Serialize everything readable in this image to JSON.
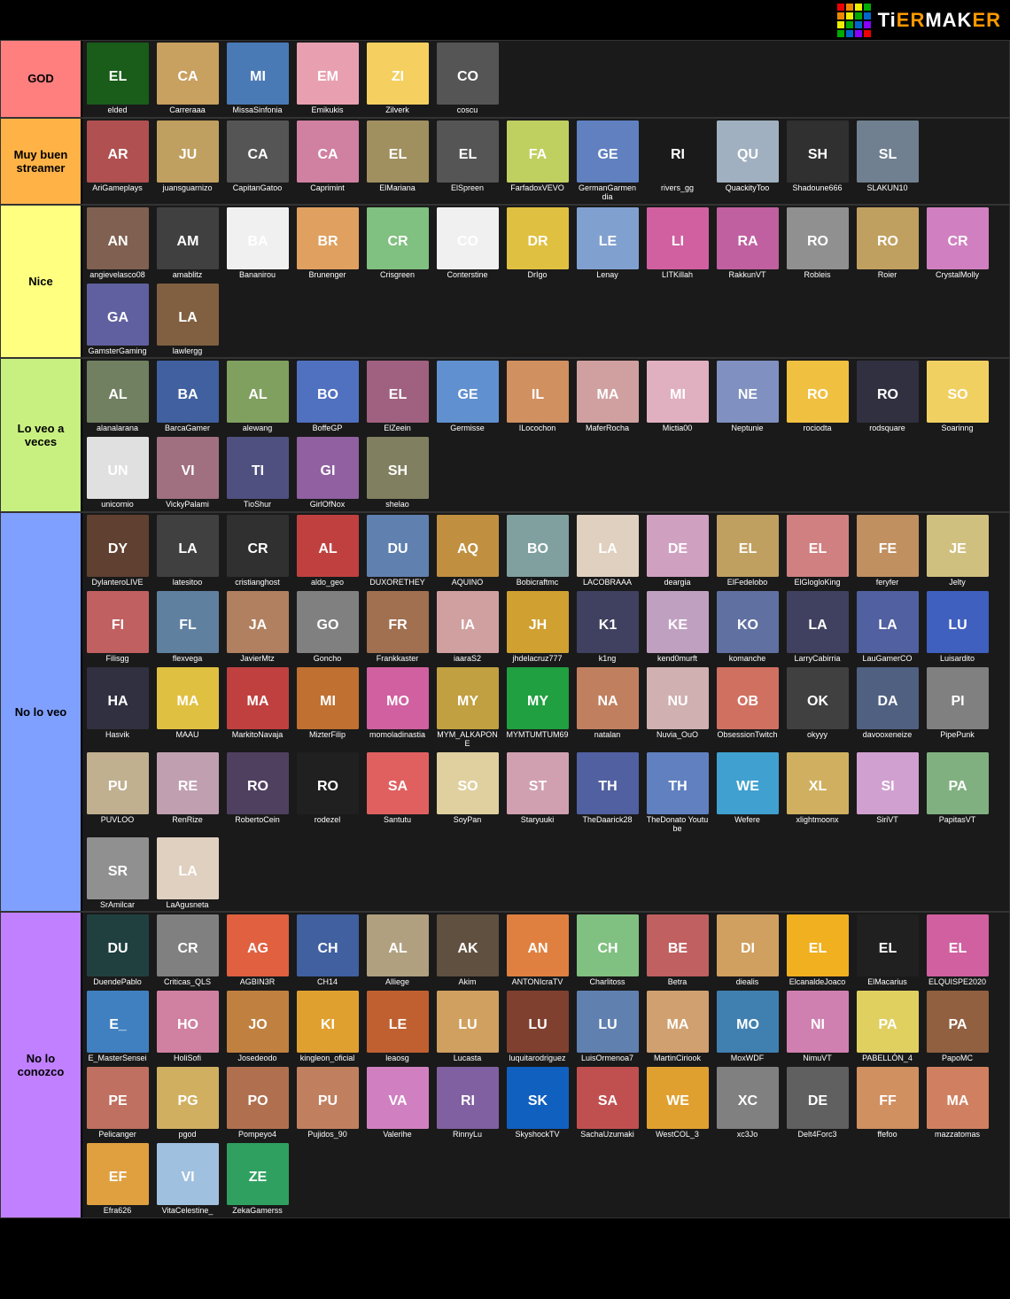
{
  "header": {
    "logo_text": "TiERMAKER"
  },
  "tiers": [
    {
      "id": "god",
      "label": "GOD",
      "color": "#ff7f7f",
      "streamers": [
        {
          "name": "elded",
          "color": "#1a5c1a"
        },
        {
          "name": "Carreraaa",
          "color": "#c8a060"
        },
        {
          "name": "MissaSinfonia",
          "color": "#4a7ab5"
        },
        {
          "name": "Emikukis",
          "color": "#e8a0b0"
        },
        {
          "name": "Zilverk",
          "color": "#f5d060"
        },
        {
          "name": "coscu",
          "color": "#555"
        }
      ]
    },
    {
      "id": "muy-buen-streamer",
      "label": "Muy buen streamer",
      "color": "#ffb347",
      "streamers": [
        {
          "name": "AriGameplays",
          "color": "#b05050"
        },
        {
          "name": "juansguarnizo",
          "color": "#c0a060"
        },
        {
          "name": "CapitanGatoo",
          "color": "#555"
        },
        {
          "name": "Caprimint",
          "color": "#d080a0"
        },
        {
          "name": "ElMariana",
          "color": "#a09060"
        },
        {
          "name": "ElSpreen",
          "color": "#555"
        },
        {
          "name": "FarfadoxVEVO",
          "color": "#c0d060"
        },
        {
          "name": "GermanGarmendia",
          "color": "#6080c0"
        },
        {
          "name": "rivers_gg",
          "color": "#1a1a1a"
        },
        {
          "name": "QuackityToo",
          "color": "#a0b0c0"
        },
        {
          "name": "Shadoune666",
          "color": "#303030"
        },
        {
          "name": "SLAKUN10",
          "color": "#708090"
        }
      ]
    },
    {
      "id": "nice",
      "label": "Nice",
      "color": "#ffff80",
      "streamers": [
        {
          "name": "angievelasco08",
          "color": "#806050"
        },
        {
          "name": "amablitz",
          "color": "#404040"
        },
        {
          "name": "Bananirou",
          "color": "#f0f0f0"
        },
        {
          "name": "Brunenger",
          "color": "#e0a060"
        },
        {
          "name": "Crisgreen",
          "color": "#80c080"
        },
        {
          "name": "Conterstine",
          "color": "#f0f0f0"
        },
        {
          "name": "DrIgo",
          "color": "#e0c040"
        },
        {
          "name": "Lenay",
          "color": "#80a0d0"
        },
        {
          "name": "LITKillah",
          "color": "#d060a0"
        },
        {
          "name": "RakkunVT",
          "color": "#c060a0"
        },
        {
          "name": "Robleis",
          "color": "#909090"
        },
        {
          "name": "Roier",
          "color": "#c0a060"
        },
        {
          "name": "CrystalMolly",
          "color": "#d080c0"
        },
        {
          "name": "GamsterGaming",
          "color": "#6060a0"
        },
        {
          "name": "lawlergg",
          "color": "#806040"
        }
      ]
    },
    {
      "id": "lo-veo-a-veces",
      "label": "Lo veo a veces",
      "color": "#c8f080",
      "streamers": [
        {
          "name": "alanalarana",
          "color": "#708060"
        },
        {
          "name": "BarcaGamer",
          "color": "#4060a0"
        },
        {
          "name": "alewang",
          "color": "#80a060"
        },
        {
          "name": "BoffeGP",
          "color": "#5070c0"
        },
        {
          "name": "ElZeein",
          "color": "#a06080"
        },
        {
          "name": "Germisse",
          "color": "#6090d0"
        },
        {
          "name": "ILocochon",
          "color": "#d09060"
        },
        {
          "name": "MaferRocha",
          "color": "#d0a0a0"
        },
        {
          "name": "Mictia00",
          "color": "#e0b0c0"
        },
        {
          "name": "Neptunie",
          "color": "#8090c0"
        },
        {
          "name": "rociodta",
          "color": "#f0c040"
        },
        {
          "name": "rodsquare",
          "color": "#303040"
        },
        {
          "name": "Soarinng",
          "color": "#f0d060"
        },
        {
          "name": "unicornio",
          "color": "#e0e0e0"
        },
        {
          "name": "VickyPalami",
          "color": "#a07080"
        },
        {
          "name": "TioShur",
          "color": "#505080"
        },
        {
          "name": "GirlOfNox",
          "color": "#9060a0"
        },
        {
          "name": "shelao",
          "color": "#808060"
        }
      ]
    },
    {
      "id": "no-lo-veo",
      "label": "No lo veo",
      "color": "#80a0ff",
      "streamers": [
        {
          "name": "DylanteroLIVE",
          "color": "#604030"
        },
        {
          "name": "latesitoo",
          "color": "#404040"
        },
        {
          "name": "cristianghost",
          "color": "#303030"
        },
        {
          "name": "aldo_geo",
          "color": "#c04040"
        },
        {
          "name": "DUXORETHEY",
          "color": "#6080b0"
        },
        {
          "name": "AQUINO",
          "color": "#c09040"
        },
        {
          "name": "Bobicraftmc",
          "color": "#80a0a0"
        },
        {
          "name": "LACOBRAAA",
          "color": "#e0d0c0"
        },
        {
          "name": "deargia",
          "color": "#d0a0c0"
        },
        {
          "name": "ElFedelobo",
          "color": "#c0a060"
        },
        {
          "name": "ElGlogloKing",
          "color": "#d08080"
        },
        {
          "name": "feryfer",
          "color": "#c09060"
        },
        {
          "name": "Jelty",
          "color": "#d0c080"
        },
        {
          "name": "Filisgg",
          "color": "#c06060"
        },
        {
          "name": "flexvega",
          "color": "#6080a0"
        },
        {
          "name": "JavierMtz",
          "color": "#b08060"
        },
        {
          "name": "Goncho",
          "color": "#808080"
        },
        {
          "name": "Frankkaster",
          "color": "#a07050"
        },
        {
          "name": "iaaraS2",
          "color": "#d0a0a0"
        },
        {
          "name": "jhdelacruz777",
          "color": "#d0a030"
        },
        {
          "name": "k1ng",
          "color": "#404060"
        },
        {
          "name": "kend0murft",
          "color": "#c0a0c0"
        },
        {
          "name": "komanche",
          "color": "#6070a0"
        },
        {
          "name": "LarryCabirria",
          "color": "#404060"
        },
        {
          "name": "LauGamerCO",
          "color": "#5060a0"
        },
        {
          "name": "Luisardito",
          "color": "#4060c0"
        },
        {
          "name": "Hasvik",
          "color": "#303040"
        },
        {
          "name": "MAAU",
          "color": "#e0c040"
        },
        {
          "name": "MarkitoNavaja",
          "color": "#c04040"
        },
        {
          "name": "MizterFilip",
          "color": "#c07030"
        },
        {
          "name": "momoladinastia",
          "color": "#d060a0"
        },
        {
          "name": "MYM_ALKAPONE",
          "color": "#c0a040"
        },
        {
          "name": "MYMTUMTUM69",
          "color": "#20a040"
        },
        {
          "name": "natalan",
          "color": "#c08060"
        },
        {
          "name": "Nuvia_OuO",
          "color": "#d0b0b0"
        },
        {
          "name": "ObsessionTwitch",
          "color": "#d07060"
        },
        {
          "name": "okyyy",
          "color": "#404040"
        },
        {
          "name": "davooxeneize",
          "color": "#506080"
        },
        {
          "name": "PipePunk",
          "color": "#808080"
        },
        {
          "name": "PUVLOO",
          "color": "#c0b090"
        },
        {
          "name": "RenRize",
          "color": "#c0a0b0"
        },
        {
          "name": "RobertoCein",
          "color": "#504060"
        },
        {
          "name": "rodezel",
          "color": "#202020"
        },
        {
          "name": "Santutu",
          "color": "#e06060"
        },
        {
          "name": "SoyPan",
          "color": "#e0d0a0"
        },
        {
          "name": "Staryuuki",
          "color": "#d0a0b0"
        },
        {
          "name": "TheDaarick28",
          "color": "#5060a0"
        },
        {
          "name": "TheDonato Youtube",
          "color": "#6080c0"
        },
        {
          "name": "Wefere",
          "color": "#40a0d0"
        },
        {
          "name": "xlightmoonx",
          "color": "#d0b060"
        },
        {
          "name": "SiriVT",
          "color": "#d0a0d0"
        },
        {
          "name": "PapitasVT",
          "color": "#80b080"
        },
        {
          "name": "SrAmilcar",
          "color": "#909090"
        },
        {
          "name": "LaAgusneta",
          "color": "#e0d0c0"
        }
      ]
    },
    {
      "id": "no-lo-conozco",
      "label": "No lo conozco",
      "color": "#c080ff",
      "streamers": [
        {
          "name": "DuendePablo",
          "color": "#204040"
        },
        {
          "name": "Criticas_QLS",
          "color": "#808080"
        },
        {
          "name": "AGBIN3R",
          "color": "#e06040"
        },
        {
          "name": "CH14",
          "color": "#4060a0"
        },
        {
          "name": "Alliege",
          "color": "#b0a080"
        },
        {
          "name": "Akim",
          "color": "#605040"
        },
        {
          "name": "ANTONIcraTV",
          "color": "#e08040"
        },
        {
          "name": "Charlitoss",
          "color": "#80c080"
        },
        {
          "name": "Betra",
          "color": "#c06060"
        },
        {
          "name": "diealis",
          "color": "#d0a060"
        },
        {
          "name": "ElcanaldeJoaco",
          "color": "#f0b020"
        },
        {
          "name": "ElMacarius",
          "color": "#202020"
        },
        {
          "name": "ELQUISPE2020",
          "color": "#d060a0"
        },
        {
          "name": "E_MasterSensei",
          "color": "#4080c0"
        },
        {
          "name": "HoliSofi",
          "color": "#d080a0"
        },
        {
          "name": "Josedeodo",
          "color": "#c08040"
        },
        {
          "name": "kingleon_oficial",
          "color": "#e0a030"
        },
        {
          "name": "leaosg",
          "color": "#c06030"
        },
        {
          "name": "Lucasta",
          "color": "#d0a060"
        },
        {
          "name": "luquitarodriguez",
          "color": "#804030"
        },
        {
          "name": "LuisOrmenoa7",
          "color": "#6080b0"
        },
        {
          "name": "MartinCiriook",
          "color": "#d0a070"
        },
        {
          "name": "MoxWDF",
          "color": "#4080b0"
        },
        {
          "name": "NimuVT",
          "color": "#d080b0"
        },
        {
          "name": "PABELLÓN_4",
          "color": "#e0d060"
        },
        {
          "name": "PapoMC",
          "color": "#906040"
        },
        {
          "name": "Pelicanger",
          "color": "#c07060"
        },
        {
          "name": "pgod",
          "color": "#d0b060"
        },
        {
          "name": "Pompeyo4",
          "color": "#b07050"
        },
        {
          "name": "Pujidos_90",
          "color": "#c08060"
        },
        {
          "name": "Valerihe",
          "color": "#d080c0"
        },
        {
          "name": "RinnyLu",
          "color": "#8060a0"
        },
        {
          "name": "SkyshockTV",
          "color": "#1060c0"
        },
        {
          "name": "SachaUzumaki",
          "color": "#c05050"
        },
        {
          "name": "WestCOL_3",
          "color": "#e0a030"
        },
        {
          "name": "xc3Jo",
          "color": "#808080"
        },
        {
          "name": "Delt4Forc3",
          "color": "#606060"
        },
        {
          "name": "ffefoo",
          "color": "#d09060"
        },
        {
          "name": "mazzatomas",
          "color": "#d08060"
        },
        {
          "name": "Efra626",
          "color": "#e0a040"
        },
        {
          "name": "VitaCelestine_",
          "color": "#a0c0e0"
        },
        {
          "name": "ZekaGamerss",
          "color": "#30a060"
        }
      ]
    }
  ]
}
